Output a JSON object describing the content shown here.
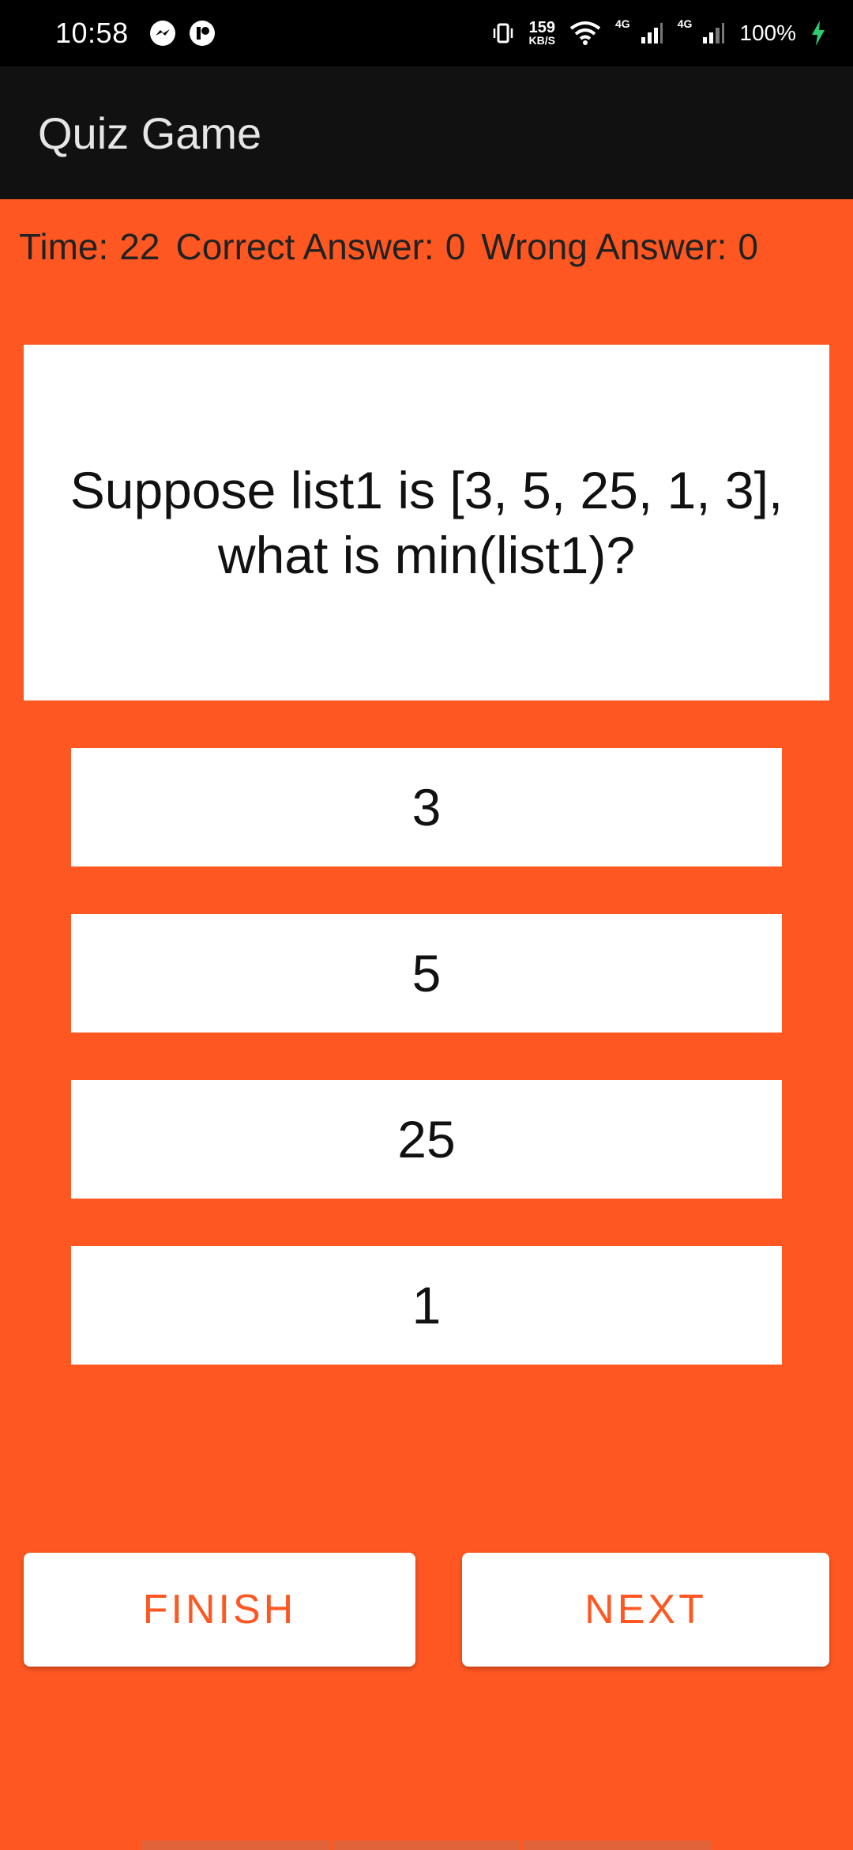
{
  "status_bar": {
    "time": "10:58",
    "net_speed_value": "159",
    "net_speed_unit": "KB/S",
    "signal1_label": "4G",
    "signal2_label": "4G",
    "battery": "100%"
  },
  "app_bar": {
    "title": "Quiz Game"
  },
  "stats": {
    "time_label": "Time:",
    "time_value": "22",
    "correct_label": "Correct Answer:",
    "correct_value": "0",
    "wrong_label": "Wrong Answer:",
    "wrong_value": "0"
  },
  "question": {
    "line1": "Suppose list1 is [3, 5, 25, 1, 3],",
    "line2": "what is min(list1)?"
  },
  "options": [
    "3",
    "5",
    "25",
    "1"
  ],
  "actions": {
    "finish": "FINISH",
    "next": "NEXT"
  },
  "colors": {
    "background": "#ff5722",
    "app_bar": "#111111",
    "accent_text": "#ff5722"
  }
}
